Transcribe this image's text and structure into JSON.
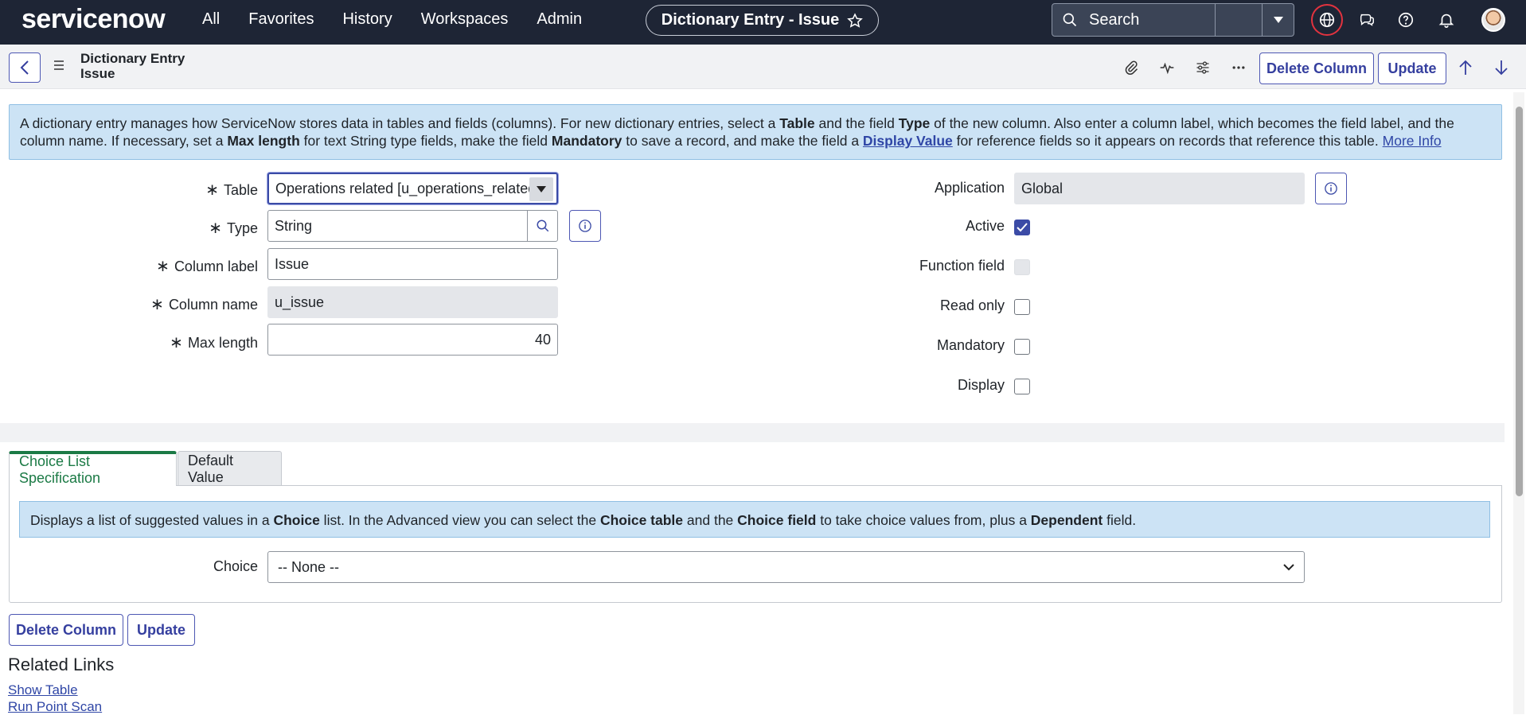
{
  "topnav": {
    "logo": "servicenow",
    "links": [
      "All",
      "Favorites",
      "History",
      "Workspaces",
      "Admin"
    ],
    "record_pill": "Dictionary Entry - Issue",
    "search_placeholder": "Search",
    "icons": [
      "globe-icon",
      "chat-icon",
      "help-icon",
      "bell-icon"
    ]
  },
  "header": {
    "title_line1": "Dictionary Entry",
    "title_line2": "Issue",
    "delete_label": "Delete Column",
    "update_label": "Update"
  },
  "info": {
    "intro": "A dictionary entry manages how ServiceNow stores data in tables and fields (columns). For new dictionary entries, select a ",
    "table": "Table",
    "t2": " and the field ",
    "type": "Type",
    "t3": " of the new column. Also enter a column label, which becomes the field label, and the column name. If necessary, set a ",
    "maxlen": "Max length",
    "t4": " for text String type fields, make the field ",
    "mandatory": "Mandatory",
    "t5": " to save a record, and make the field a ",
    "display_value": "Display Value",
    "t6": " for reference fields so it appears on records that reference this table. ",
    "more_info": "More Info"
  },
  "form": {
    "table_label": "Table",
    "table_value": "Operations related [u_operations_related]",
    "type_label": "Type",
    "type_value": "String",
    "column_label_label": "Column label",
    "column_label_value": "Issue",
    "column_name_label": "Column name",
    "column_name_value": "u_issue",
    "max_length_label": "Max length",
    "max_length_value": "40",
    "application_label": "Application",
    "application_value": "Global",
    "active_label": "Active",
    "active": true,
    "function_field_label": "Function field",
    "function_field": false,
    "read_only_label": "Read only",
    "read_only": false,
    "mandatory_label": "Mandatory",
    "mandatory": false,
    "display_label": "Display",
    "display": false
  },
  "tabs": {
    "items": [
      "Choice List Specification",
      "Default Value"
    ],
    "active": "Choice List Specification"
  },
  "choice_section": {
    "info_t1": "Displays a list of suggested values in a ",
    "choice": "Choice",
    "info_t2": " list. In the Advanced view you can select the ",
    "choice_table": "Choice table",
    "info_t3": " and the ",
    "choice_field": "Choice field",
    "info_t4": " to take choice values from, plus a ",
    "dependent": "Dependent",
    "info_t5": " field.",
    "choice_label": "Choice",
    "choice_value": "-- None --"
  },
  "footer": {
    "delete_label": "Delete Column",
    "update_label": "Update",
    "related_links_title": "Related Links",
    "links": [
      "Show Table",
      "Run Point Scan"
    ]
  },
  "colors": {
    "nav_bg": "#1e2535",
    "accent": "#3b4ba6",
    "info_bg": "#cce3f5",
    "tab_active": "#1b7a45"
  }
}
